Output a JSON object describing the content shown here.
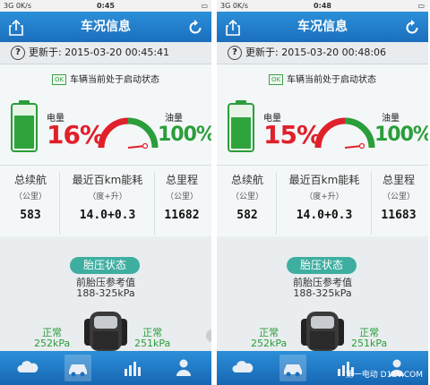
{
  "colors": {
    "nav": "#1a6fbd",
    "accent_red": "#e0202a",
    "accent_green": "#2a9e3a",
    "tire_button": "#3eaea1"
  },
  "screens": [
    {
      "status": {
        "carrier": "3G 0K/s",
        "time": "0:45"
      },
      "nav_title": "车况信息",
      "updated_prefix": "更新于:",
      "updated_time": "2015-03-20 00:45:41",
      "ok_badge": "OK",
      "state_text": "车辆当前处于启动状态",
      "battery": {
        "label": "电量",
        "value": "16%",
        "level": 0.16
      },
      "fuel": {
        "label": "油量",
        "value": "100%",
        "level": 1.0
      },
      "stats": [
        {
          "label": "总续航",
          "unit": "（公里）",
          "value": "583"
        },
        {
          "label": "最近百km能耗",
          "unit": "（度+升）",
          "value": "14.0+0.3"
        },
        {
          "label": "总里程",
          "unit": "（公里）",
          "value": "11682"
        }
      ],
      "tire": {
        "button": "胎压状态",
        "ref_label": "前胎压参考值",
        "ref_range": "188-325kPa",
        "left_status": "正常",
        "left_value": "252kPa",
        "right_status": "正常",
        "right_value": "251kPa"
      },
      "tabs": [
        "cloud-icon",
        "car-icon",
        "bar-chart-icon",
        "user-icon"
      ]
    },
    {
      "status": {
        "carrier": "3G 0K/s",
        "time": "0:48"
      },
      "nav_title": "车况信息",
      "updated_prefix": "更新于:",
      "updated_time": "2015-03-20 00:48:06",
      "ok_badge": "OK",
      "state_text": "车辆当前处于启动状态",
      "battery": {
        "label": "电量",
        "value": "15%",
        "level": 0.15
      },
      "fuel": {
        "label": "油量",
        "value": "100%",
        "level": 1.0
      },
      "stats": [
        {
          "label": "总续航",
          "unit": "（公里）",
          "value": "582"
        },
        {
          "label": "最近百km能耗",
          "unit": "（度+升）",
          "value": "14.0+0.3"
        },
        {
          "label": "总里程",
          "unit": "（公里）",
          "value": "11683"
        }
      ],
      "tire": {
        "button": "胎压状态",
        "ref_label": "前胎压参考值",
        "ref_range": "188-325kPa",
        "left_status": "正常",
        "left_value": "252kPa",
        "right_status": "正常",
        "right_value": "251kPa"
      },
      "tabs": [
        "cloud-icon",
        "car-icon",
        "bar-chart-icon",
        "user-icon"
      ]
    }
  ],
  "watermark": "第一电动 D1EV.COM"
}
